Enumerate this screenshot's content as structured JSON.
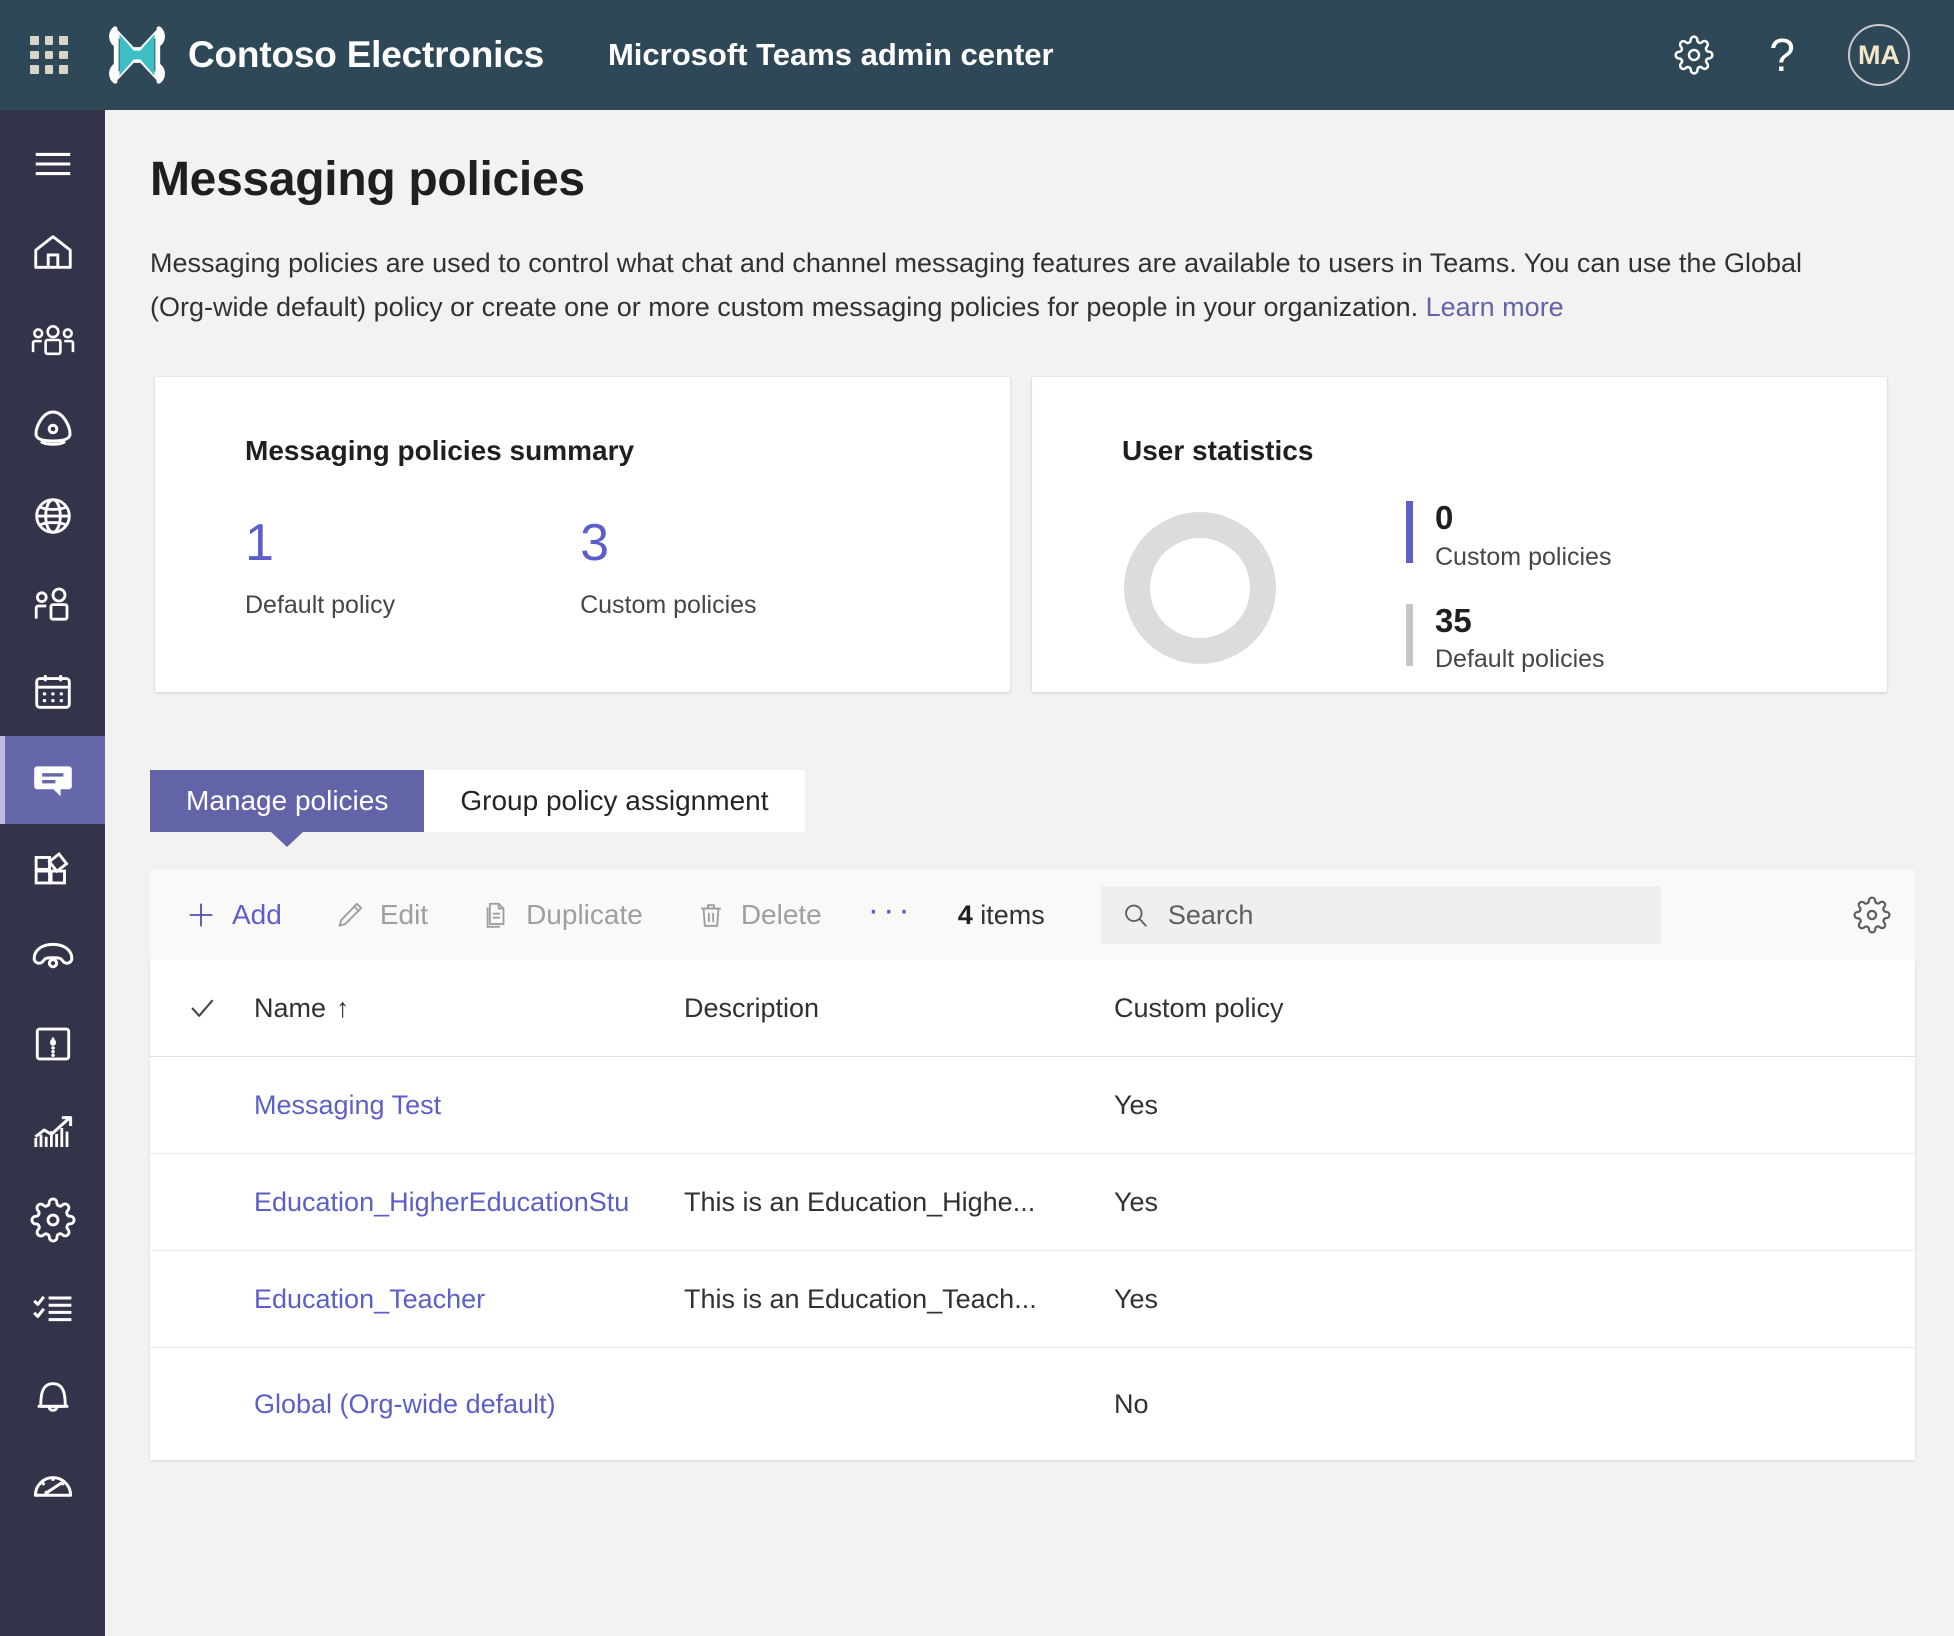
{
  "topbar": {
    "waffle_icon": "app-launcher-icon",
    "logo_icon": "contoso-drone-logo",
    "brand": "Contoso Electronics",
    "app_title": "Microsoft Teams admin center",
    "settings_icon": "gear-icon",
    "help_icon": "question-mark-icon",
    "avatar_initials": "MA"
  },
  "sidebar": {
    "items": [
      {
        "name": "hamburger-menu",
        "icon": "hamburger-icon"
      },
      {
        "name": "home",
        "icon": "home-icon"
      },
      {
        "name": "teams",
        "icon": "teams-group-icon"
      },
      {
        "name": "devices",
        "icon": "device-headset-icon"
      },
      {
        "name": "locations",
        "icon": "globe-icon"
      },
      {
        "name": "users",
        "icon": "users-icon"
      },
      {
        "name": "meetings",
        "icon": "calendar-icon"
      },
      {
        "name": "messaging-policies",
        "icon": "chat-bubble-icon",
        "active": true
      },
      {
        "name": "teams-apps",
        "icon": "apps-grid-icon"
      },
      {
        "name": "voice",
        "icon": "phone-icon"
      },
      {
        "name": "policy-packages",
        "icon": "package-icon"
      },
      {
        "name": "analytics-reports",
        "icon": "bar-chart-icon"
      },
      {
        "name": "org-wide-settings",
        "icon": "gear-icon"
      },
      {
        "name": "planning",
        "icon": "checklist-icon"
      },
      {
        "name": "notifications-alerts",
        "icon": "bell-icon"
      },
      {
        "name": "call-quality-dashboard",
        "icon": "gauge-icon"
      }
    ]
  },
  "page": {
    "title": "Messaging policies",
    "description": "Messaging policies are used to control what chat and channel messaging features are available to users in Teams. You can use the Global (Org-wide default) policy or create one or more custom messaging policies for people in your organization. ",
    "learn_more": "Learn more"
  },
  "summary_card": {
    "title": "Messaging policies summary",
    "stats": [
      {
        "value": "1",
        "label": "Default policy"
      },
      {
        "value": "3",
        "label": "Custom policies"
      }
    ]
  },
  "user_statistics": {
    "title": "User statistics",
    "legend": [
      {
        "value": "0",
        "label": "Custom policies",
        "color": "#5B5FC7"
      },
      {
        "value": "35",
        "label": "Default policies",
        "color": "#C8C6C4"
      }
    ]
  },
  "chart_data": {
    "type": "pie",
    "title": "User statistics",
    "categories": [
      "Custom policies",
      "Default policies"
    ],
    "values": [
      0,
      35
    ],
    "colors": [
      "#5B5FC7",
      "#DCDCDC"
    ],
    "legend_position": "right",
    "donut": true
  },
  "tabs": [
    {
      "label": "Manage policies",
      "active": true
    },
    {
      "label": "Group policy assignment",
      "active": false
    }
  ],
  "toolbar": {
    "add_label": "Add",
    "edit_label": "Edit",
    "duplicate_label": "Duplicate",
    "delete_label": "Delete",
    "more_label": "···",
    "item_count_value": "4",
    "item_count_unit": " items",
    "search_placeholder": "Search",
    "search_value": "",
    "settings_icon": "gear-icon"
  },
  "table": {
    "columns": [
      "Name",
      "Description",
      "Custom policy"
    ],
    "sort_column": "Name",
    "sort_direction": "↑",
    "rows": [
      {
        "name": "Messaging Test",
        "description": "",
        "custom_policy": "Yes"
      },
      {
        "name": "Education_HigherEducationStu",
        "description": "This is an Education_Highe...",
        "custom_policy": "Yes"
      },
      {
        "name": "Education_Teacher",
        "description": "This is an Education_Teach...",
        "custom_policy": "Yes"
      },
      {
        "name": "Global (Org-wide default)",
        "description": "",
        "custom_policy": "No"
      }
    ]
  }
}
